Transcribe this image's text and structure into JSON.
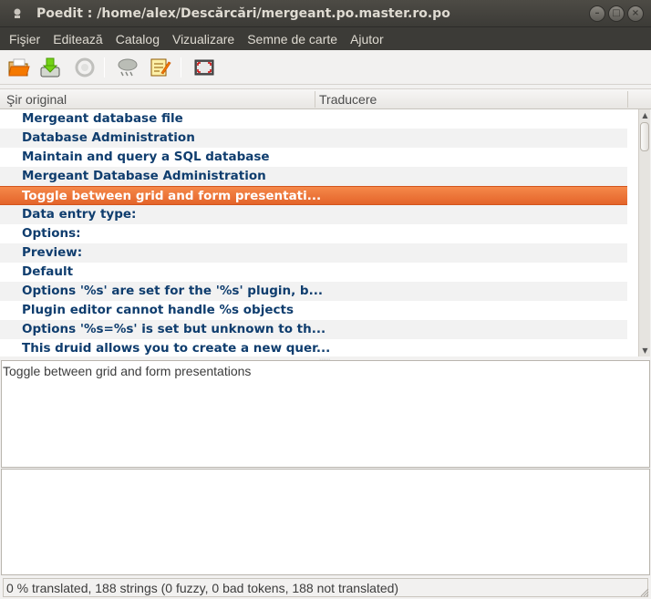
{
  "window": {
    "title": "Poedit : /home/alex/Descărcări/mergeant.po.master.ro.po"
  },
  "menu": [
    "Fişier",
    "Editează",
    "Catalog",
    "Vizualizare",
    "Semne de carte",
    "Ajutor"
  ],
  "toolbar": {
    "buttons": [
      "open-folder-icon",
      "save-icon",
      "update-catalog-icon",
      "validate-icon",
      "comment-icon",
      "fullscreen-icon"
    ]
  },
  "columns": {
    "original": "Şir original",
    "translation": "Traducere"
  },
  "strings": [
    "Mergeant database file",
    "Database Administration",
    "Maintain and query a SQL database",
    "Mergeant Database Administration",
    "Toggle between grid and form presentati...",
    "Data entry type:",
    "Options:",
    "Preview:",
    "Default",
    "Options '%s' are set for the '%s' plugin, b...",
    "Plugin editor cannot handle %s objects",
    "Options '%s=%s' is set but unknown to th...",
    "This druid allows you to create a new quer..."
  ],
  "selected_index": 4,
  "panes": {
    "original_text": "Toggle between grid and form presentations",
    "translation_text": ""
  },
  "status": "0 % translated, 188 strings (0 fuzzy, 0 bad tokens, 188 not translated)",
  "colors": {
    "selection": "#e8672d",
    "menubar": "#3c3b37",
    "string_text": "#0f3d6e"
  }
}
